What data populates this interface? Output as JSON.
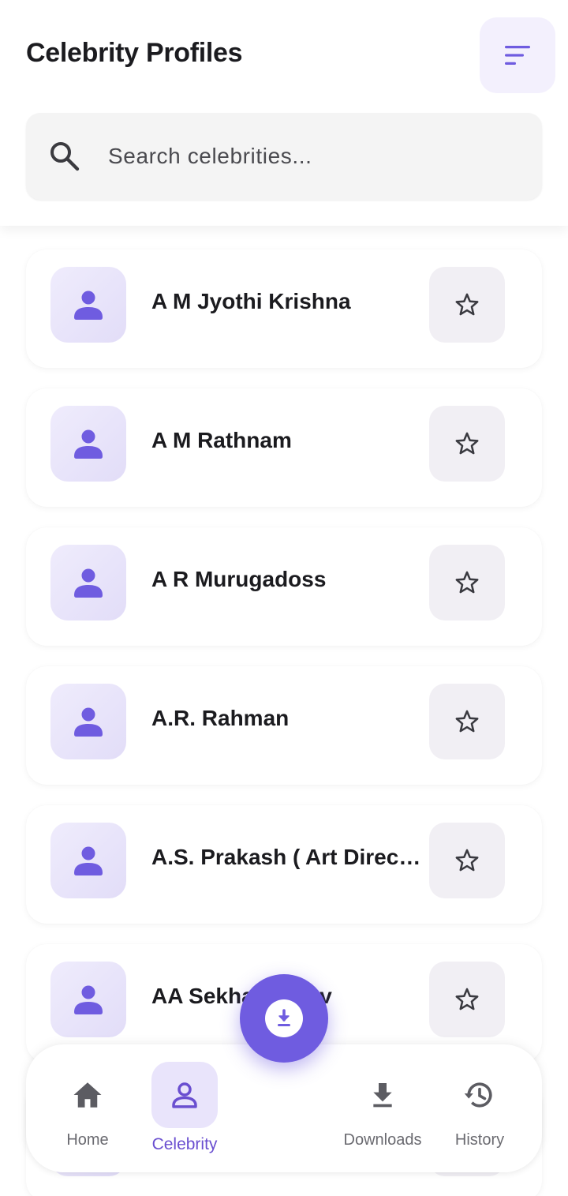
{
  "header": {
    "title": "Celebrity Profiles",
    "filter_icon": "sort-lines-icon"
  },
  "search": {
    "placeholder": "Search celebrities...",
    "value": ""
  },
  "celebrities": [
    {
      "name": "A M Jyothi Krishna"
    },
    {
      "name": "A M Rathnam"
    },
    {
      "name": "A R Murugadoss"
    },
    {
      "name": "A.R. Rahman"
    },
    {
      "name": "A.S. Prakash ( Art Director )"
    },
    {
      "name": "AA Sekhar Yadav"
    },
    {
      "name": ""
    }
  ],
  "nav": {
    "items": [
      {
        "label": "Home",
        "icon": "home-icon",
        "active": false
      },
      {
        "label": "Celebrity",
        "icon": "person-icon",
        "active": true
      },
      {
        "label": "Downloads",
        "icon": "download-icon",
        "active": false
      },
      {
        "label": "History",
        "icon": "history-icon",
        "active": false
      }
    ]
  },
  "fab": {
    "icon": "download-circle-icon"
  },
  "colors": {
    "accent": "#6F5CE0",
    "accent_light": "#E9E4FB",
    "text": "#1B1B1F",
    "muted": "#6A6A70"
  }
}
